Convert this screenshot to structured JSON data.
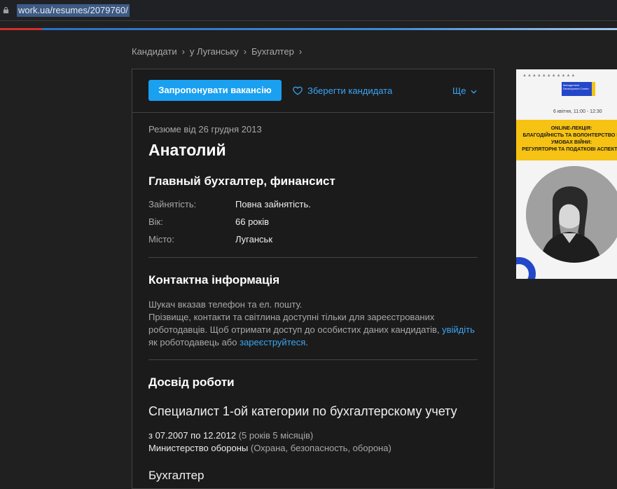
{
  "browser": {
    "url": "work.ua/resumes/2079760/"
  },
  "colors": {
    "accent": "#1aa0f0",
    "link": "#39a6f5",
    "background": "#202020",
    "card": "#1b1b1b"
  },
  "breadcrumb": {
    "items": [
      "Кандидати",
      "у Луганську",
      "Бухгалтер"
    ],
    "separator": "›"
  },
  "actions": {
    "offer_label": "Запропонувати вакансію",
    "save_label": "Зберегти кандидата",
    "more_label": "Ще"
  },
  "resume": {
    "date": "Резюме від 26 грудня 2013",
    "name": "Анатолий",
    "position": "Главный бухгалтер, финансист",
    "props": [
      {
        "key": "Зайнятість:",
        "value": "Повна зайнятість."
      },
      {
        "key": "Вік:",
        "value": "66 років"
      },
      {
        "key": "Місто:",
        "value": "Луганськ"
      }
    ]
  },
  "contact": {
    "heading": "Контактна інформація",
    "line1": "Шукач вказав телефон та ел. пошту.",
    "line2": "Прізвище, контакти та світлина доступні тільки для зареєстрованих роботодавців. Щоб отримати доступ до особистих даних кандидатів,",
    "login_link": "увійдіть",
    "line3": "як роботодавець або",
    "register_link": "зареєструйтеся",
    "end": "."
  },
  "experience": {
    "heading": "Досвід роботи",
    "jobs": [
      {
        "title": "Специалист 1-ой категории по бухгалтерскому учету",
        "period": "з 07.2007 по 12.2012",
        "duration": "(5 років 5 місяців)",
        "company": "Министерство обороны",
        "industry": "(Охрана, безопасность, оборона)"
      },
      {
        "title": "Бухгалтер"
      }
    ]
  },
  "ad": {
    "date": "6 квітня, 11:00 - 12:30",
    "line1": "ONLINE-ЛЕКЦІЯ:",
    "line2": "БЛАГОДІЙНІСТЬ ТА ВОЛОНТЕРСТВО В",
    "line3": "УМОВАХ ВІЙНИ:",
    "line4": "РЕГУЛЯТОРНІ ТА ПОДАТКОВІ АСПЕКТИ",
    "logo_text": "Management Development Centre"
  }
}
